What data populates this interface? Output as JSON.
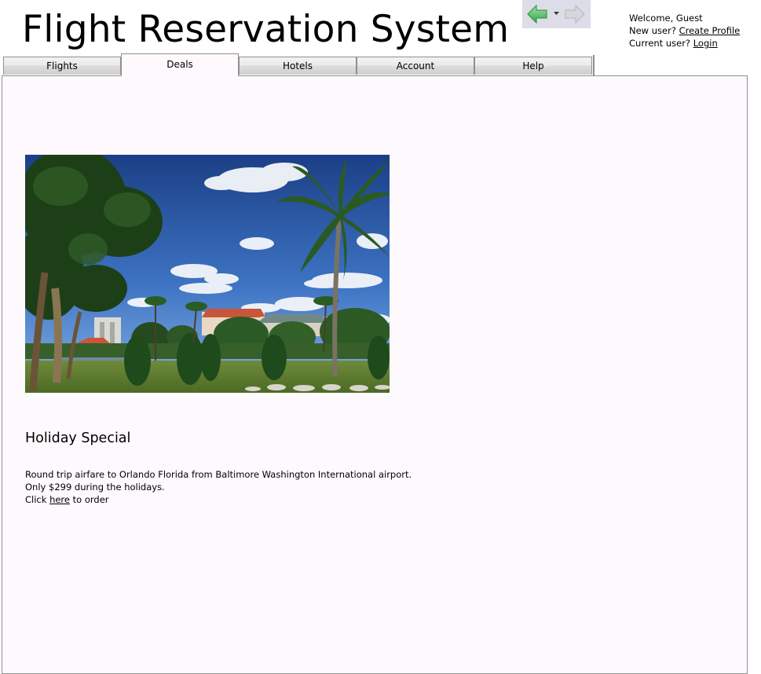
{
  "app": {
    "title": "Flight Reservation System"
  },
  "navigation": {
    "back_icon": "back-arrow-icon",
    "history_icon": "dropdown-arrow-icon",
    "forward_icon": "forward-arrow-icon",
    "bar_color": "#dcdde8"
  },
  "user_panel": {
    "welcome": "Welcome, Guest",
    "new_user_label": "New user?",
    "create_profile_link": "Create Profile",
    "current_user_label": "Current user?",
    "login_link": "Login"
  },
  "tabs": [
    {
      "label": "Flights",
      "active": false
    },
    {
      "label": "Deals",
      "active": true
    },
    {
      "label": "Hotels",
      "active": false
    },
    {
      "label": "Account",
      "active": false
    },
    {
      "label": "Help",
      "active": false
    }
  ],
  "deal": {
    "image": "tropical-resort-palm-trees-photo",
    "title": "Holiday Special",
    "line1": "Round trip airfare to Orlando Florida from Baltimore Washington International airport.",
    "line2": "Only $299 during the holidays.",
    "click_prefix": "Click",
    "here_link": "here",
    "click_suffix": "to order"
  },
  "colors": {
    "content_background": "#fdf9fd",
    "border": "#8e8f8f",
    "back_arrow": "#5fc26f"
  }
}
